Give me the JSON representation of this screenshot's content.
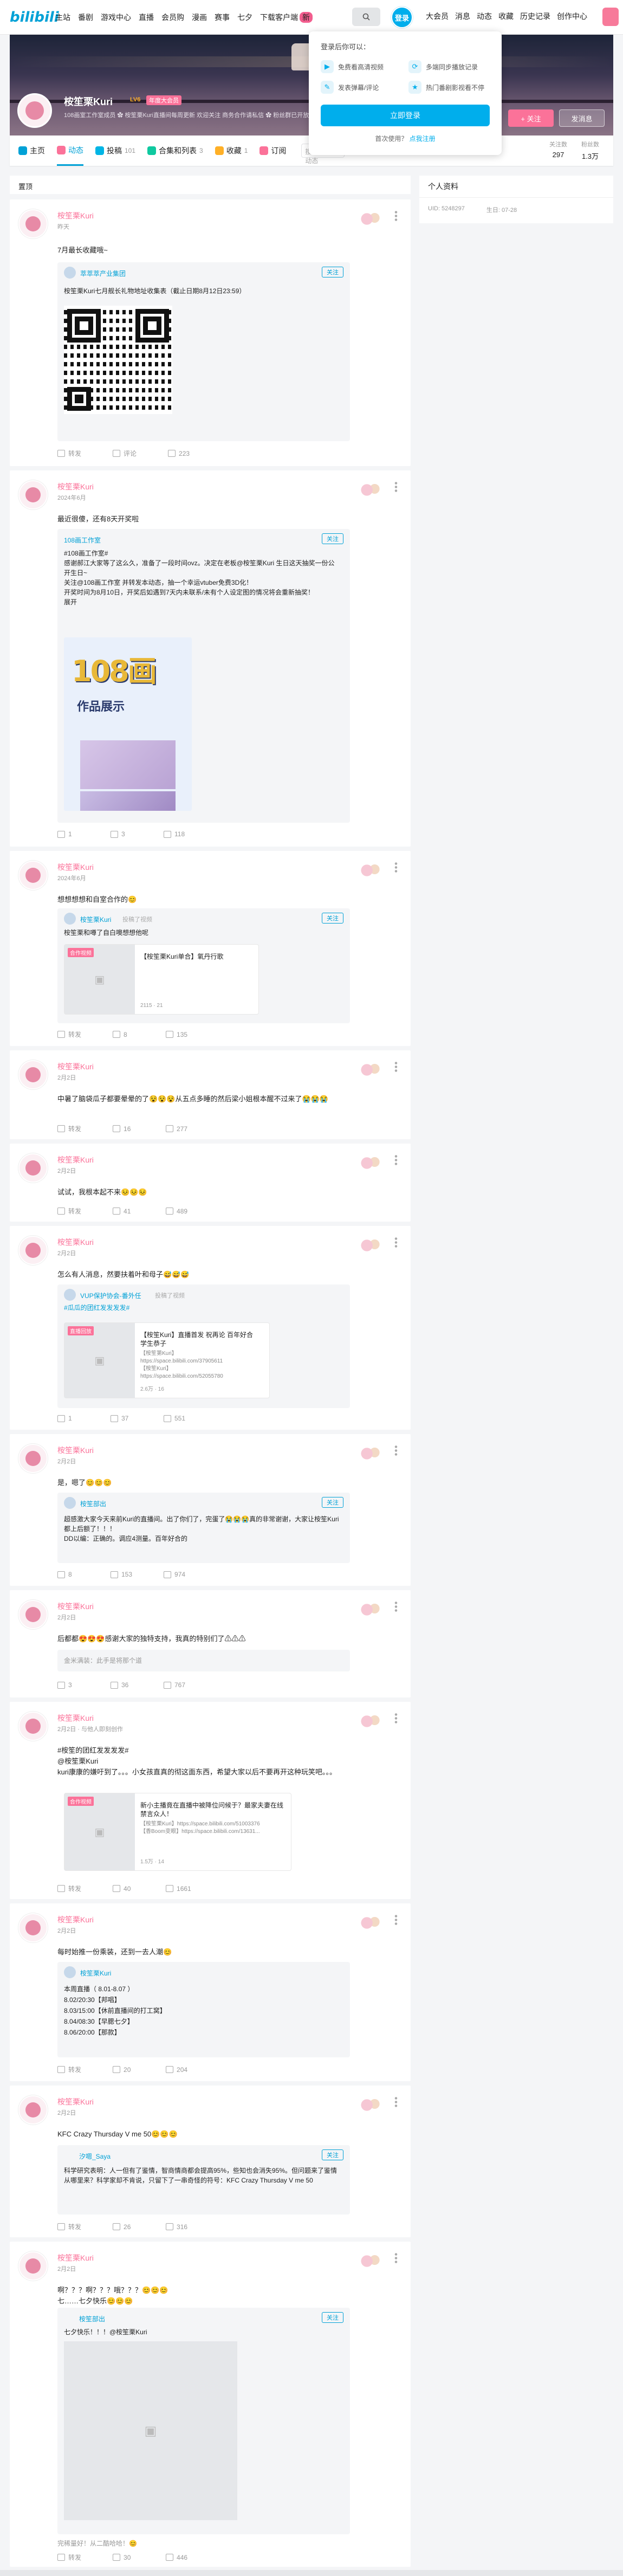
{
  "nav": {
    "logo": "bilibili",
    "items": [
      "主站",
      "番剧",
      "游戏中心",
      "直播",
      "会员购",
      "漫画",
      "赛事",
      "七夕"
    ],
    "download": "下载客户端",
    "download_badge": "新",
    "login": "登录",
    "right_items": [
      "大会员",
      "消息",
      "动态",
      "收藏",
      "历史记录",
      "创作中心"
    ]
  },
  "banner": {
    "username": "桉笙栗Kuri",
    "level": "LV6",
    "vip": "年度大会员",
    "sign": "108画室工作室成员 ✿ 桉笙栗Kuri直播间每周更新 欢迎关注 商务合作请私信 ✿ 粉丝群已开放",
    "follow": "+ 关注",
    "message": "发消息"
  },
  "tabs": [
    {
      "label": "主页",
      "count": "",
      "color": "#00a1d6"
    },
    {
      "label": "动态",
      "count": "",
      "color": "#fb7299"
    },
    {
      "label": "投稿",
      "count": "101",
      "color": "#00b5e5"
    },
    {
      "label": "合集和列表",
      "count": "3",
      "color": "#0fc9a0"
    },
    {
      "label": "收藏",
      "count": "1",
      "color": "#ffb027"
    },
    {
      "label": "订阅",
      "count": "",
      "color": "#fb7299"
    }
  ],
  "search_placeholder": "搜索视频、动态",
  "stats": [
    {
      "k": "关注数",
      "v": "297"
    },
    {
      "k": "粉丝数",
      "v": "1.3万"
    }
  ],
  "dropdown": {
    "title": "登录后你可以：",
    "items": [
      {
        "icon": "▶",
        "label": "免费看高清视频"
      },
      {
        "icon": "⟳",
        "label": "多端同步播放记录"
      },
      {
        "icon": "✎",
        "label": "发表弹幕/评论"
      },
      {
        "icon": "★",
        "label": "热门番剧影视看不停"
      }
    ],
    "button": "立即登录",
    "register_prompt": "首次使用？",
    "register_link": "点我注册"
  },
  "feed_head": "置顶",
  "right_panel": {
    "title": "个人资料",
    "uid": "UID: 5248297",
    "birthday": "生日: 07-28"
  },
  "cards": [
    {
      "name": "桉笙栗Kuri",
      "time": "昨天",
      "text": "7月最长收藏哦~",
      "repost": {
        "name": "萃萃萃产业集团",
        "sub": "",
        "text": "桉笙栗Kuri七月舰长礼物地址收集表（截止日期8月12日23:59）"
      },
      "actions": [
        "转发",
        "评论",
        "223"
      ]
    },
    {
      "name": "桉笙栗Kuri",
      "time": "2024年6月",
      "text": "最近很傻，还有8天开奖啦",
      "repost": {
        "name": "108画工作室",
        "sub": "",
        "text": "#108画工作室#\n感谢郝江大家等了这么久，准备了一段时间ovz。决定在老板@桉笙栗Kuri 生日这天抽奖一份公开生日~\n关注@108画工作室 并转发本动态，抽一个幸运vtuber免费3D化！\n开奖时间为8月10日，开奖后如遇到7天内未联系/未有个人设定图的情况将会重新抽奖！\n展开",
        "poster_title": "108画",
        "poster_sub": "作品展示"
      },
      "actions": [
        "1",
        "3",
        "118"
      ]
    },
    {
      "name": "桉笙栗Kuri",
      "time": "2024年6月",
      "text": "想想想想和自室合作的😊",
      "repost": {
        "name": "桉笙栗Kuri",
        "sub": "投稿了视频",
        "text": "桉笙栗和噂了自白噢想想他呢",
        "video": {
          "badge": "合作视频",
          "title": "【桉笙栗Kuri单合】氧丹行歌",
          "desc": "",
          "stat": "2115 · 21"
        }
      },
      "actions": [
        "转发",
        "8",
        "135"
      ]
    },
    {
      "name": "桉笙栗Kuri",
      "time": "2月2日",
      "text": "中暑了脑袋瓜子都要晕晕的了😵😵😵从五点多睡的然后梁小姐根本醒不过来了😭😭😭",
      "actions": [
        "转发",
        "16",
        "277"
      ]
    },
    {
      "name": "桉笙栗Kuri",
      "time": "2月2日",
      "text": "试试，我根本起不来😣😣😣",
      "actions": [
        "转发",
        "41",
        "489"
      ]
    },
    {
      "name": "桉笙栗Kuri",
      "time": "2月2日",
      "text": "怎么有人消息，然要扶着叶和母子😅😅😅",
      "repost": {
        "name": "VUP保护协会-番外任",
        "sub": "投稿了视频",
        "text": "#瓜瓜的团红发发发发#",
        "video": {
          "badge": "直播回放",
          "title": "【桉笙Kuri】直播首发 祝再论 百年好合 学生恭子",
          "desc": "【桉笙第Kuri】https://space.bilibili.com/37905611\n【桉笙Kuri】https://space.bilibili.com/52055780",
          "stat": "2.6万 · 16"
        }
      },
      "actions": [
        "1",
        "37",
        "551"
      ]
    },
    {
      "name": "桉笙栗Kuri",
      "time": "2月2日",
      "text": "是，嗯了😊😊😊",
      "repost": {
        "name": "桉笙部出",
        "sub": "",
        "text": "超感激大家今天来前Kuri的直播间。出了你们了，完蛋了😭😭😭真的非常谢谢，大家让桉笙Kuri都上后额了！！！\n   DD以编：正确的。调应4测量。百年好合的"
      },
      "actions": [
        "8",
        "153",
        "974"
      ]
    },
    {
      "name": "桉笙栗Kuri",
      "time": "2月2日",
      "text": "后都都😍😍😍感谢大家的独特支持，我真的特别们了⚠⚠⚠",
      "repost": {
        "name": "",
        "sub": "",
        "text": "金米满装：此手是将那个道"
      },
      "actions": [
        "3",
        "36",
        "767"
      ]
    },
    {
      "name": "桉笙栗Kuri",
      "time": "2月2日 · 与他人即刻创作",
      "text": "#桉笙的团红发发发发#\n@桉笙栗Kuri\nkuri康康的嫌吁到了。。。小女孩直真的彻这面东西，希望大家以后不要再开这种玩笑吧。。。",
      "repost": {
        "name": "",
        "sub": "",
        "text": "",
        "video": {
          "badge": "合作视频",
          "title": "新小主播竟在直播中被降位问候于？最家夫妻在线禁言众人！",
          "desc": "【桉笙栗Kuri】https://space.bilibili.com/51003376\n【香Boom变眼】https://space.bilibili.com/13631...",
          "stat": "1.5万 · 14"
        }
      },
      "actions": [
        "转发",
        "40",
        "1661"
      ]
    },
    {
      "name": "桉笙栗Kuri",
      "time": "2月2日",
      "text": "每时始推一份乘装，还到一去人潮😊",
      "repost": {
        "name": "桉笙栗Kuri",
        "sub": "",
        "text": "本周直播（ 8.01-8.07 ）\n8.02/20:30【邦唱】\n8.03/15:00【休前直播间的打工窝】\n8.04/08:30【早腮七夕】\n8.06/20:00【那款】"
      },
      "actions": [
        "转发",
        "20",
        "204"
      ]
    },
    {
      "name": "桉笙栗Kuri",
      "time": "2月2日",
      "text": "KFC Crazy Thursday V me 50😊😊😊",
      "repost": {
        "name": "汐嗯_Saya",
        "sub": "",
        "text": "科学研究表明：人一但有了鉴情，智商情商都会提高95%，些知也会消失95%。但问题来了鉴情从哪里来？科学家却不肯说，只留下了一串奇怪的符号：KFC Crazy Thursday V me 50"
      },
      "actions": [
        "转发",
        "26",
        "316"
      ]
    },
    {
      "name": "桉笙栗Kuri",
      "time": "2月2日",
      "text": "啊？？？啊？？？哦？？？😊😊😊\n七……七夕快乐😊😊😊",
      "repost": {
        "name": "桉笙部出",
        "sub": "",
        "text": "七夕快乐！！！@桉笙栗Kuri",
        "comment": "完稀量好！从二酷哈哈！😊"
      },
      "actions": [
        "转发",
        "30",
        "446"
      ]
    }
  ]
}
